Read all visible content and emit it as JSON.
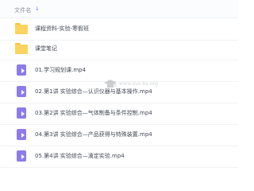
{
  "header": {
    "column_name": "文件名",
    "sort_icon": "arrow-down-icon"
  },
  "items": [
    {
      "type": "folder",
      "icon": "folder-icon",
      "name": "课程资料-实验-寒假班"
    },
    {
      "type": "folder",
      "icon": "folder-icon",
      "name": "课堂笔记"
    },
    {
      "type": "video",
      "icon": "video-file-icon",
      "name": "01.学习规划课.mp4"
    },
    {
      "type": "video",
      "icon": "video-file-icon",
      "name": "02.第1讲  实验综合—认识仪器与基本操作.mp4"
    },
    {
      "type": "video",
      "icon": "video-file-icon",
      "name": "03.第2讲  实验综合—气体制备与条件控制.mp4"
    },
    {
      "type": "video",
      "icon": "video-file-icon",
      "name": "04.第3讲  实验综合—产品获得与特殊装置.mp4"
    },
    {
      "type": "video",
      "icon": "video-file-icon",
      "name": "05.第4讲  实验综合—滴定实验.mp4"
    }
  ],
  "watermark": {
    "text": "www.xue-ba.org",
    "icon": "graduation-cap-icon"
  },
  "colors": {
    "folder": "#fbd35f",
    "video": "#8c7be8",
    "accent": "#5e8de6"
  }
}
